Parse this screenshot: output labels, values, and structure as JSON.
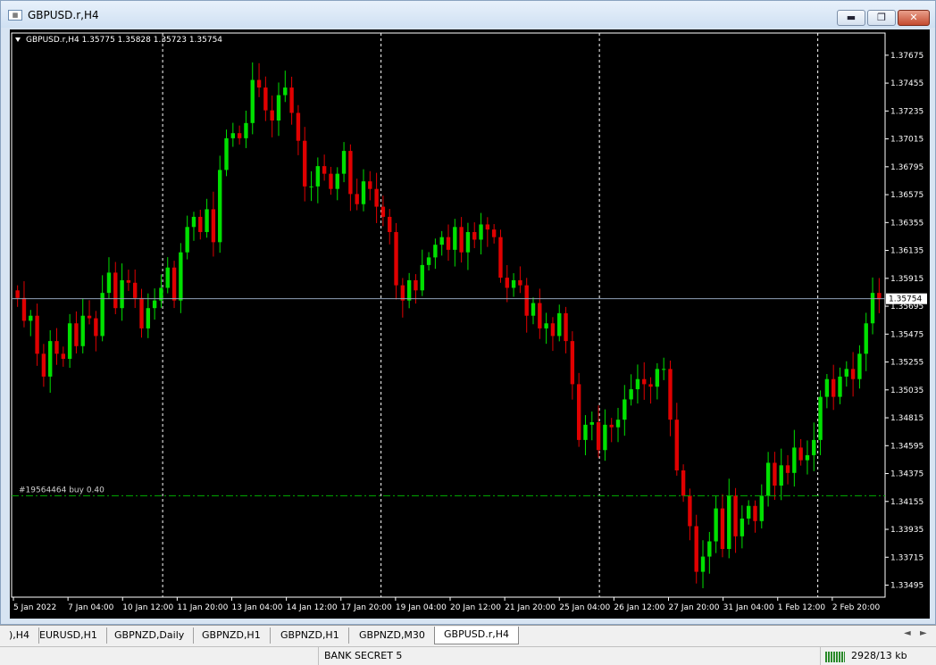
{
  "window": {
    "title": "GBPUSD.r,H4",
    "min_label": "▬",
    "max_label": "❐",
    "close_label": "✕"
  },
  "chart": {
    "header": "GBPUSD.r,H4  1.35775 1.35828 1.35723 1.35754",
    "current_price_label": "1.35754",
    "order_label": "#19564464 buy 0.40",
    "colors": {
      "bull": "#00e000",
      "bear": "#e00000",
      "bg": "#000000",
      "grid": "#ffffff",
      "price_line": "#8fa0b8",
      "order_line": "#00b000"
    }
  },
  "chart_data": {
    "type": "candlestick",
    "symbol": "GBPUSD.r",
    "timeframe": "H4",
    "ylim": [
      1.334,
      1.3785
    ],
    "y_ticks": [
      "1.37675",
      "1.37455",
      "1.37235",
      "1.37015",
      "1.36795",
      "1.36575",
      "1.36355",
      "1.36135",
      "1.35915",
      "1.35695",
      "1.35475",
      "1.35255",
      "1.35035",
      "1.34815",
      "1.34595",
      "1.34375",
      "1.34155",
      "1.33935",
      "1.33715",
      "1.33495"
    ],
    "x_ticks": [
      "5 Jan 2022",
      "7 Jan 04:00",
      "10 Jan 12:00",
      "11 Jan 20:00",
      "13 Jan 04:00",
      "14 Jan 12:00",
      "17 Jan 20:00",
      "19 Jan 04:00",
      "20 Jan 12:00",
      "21 Jan 20:00",
      "25 Jan 04:00",
      "26 Jan 12:00",
      "27 Jan 20:00",
      "31 Jan 04:00",
      "1 Feb 12:00",
      "2 Feb 20:00"
    ],
    "current_price": 1.35754,
    "order": {
      "price": 1.342
    },
    "closes": [
      1.3576,
      1.3558,
      1.3562,
      1.3532,
      1.3514,
      1.3542,
      1.3532,
      1.3528,
      1.3556,
      1.3538,
      1.3562,
      1.356,
      1.3546,
      1.358,
      1.3596,
      1.3568,
      1.359,
      1.3588,
      1.3576,
      1.3552,
      1.3568,
      1.3574,
      1.3584,
      1.36,
      1.3574,
      1.3612,
      1.3632,
      1.364,
      1.3628,
      1.3646,
      1.362,
      1.3677,
      1.3702,
      1.3706,
      1.3702,
      1.3714,
      1.3748,
      1.3742,
      1.3724,
      1.3716,
      1.3736,
      1.3742,
      1.3722,
      1.37,
      1.3664,
      1.3664,
      1.368,
      1.3674,
      1.3662,
      1.3674,
      1.3692,
      1.3658,
      1.365,
      1.3668,
      1.3662,
      1.3648,
      1.364,
      1.3628,
      1.3586,
      1.3574,
      1.359,
      1.3582,
      1.3602,
      1.3608,
      1.3618,
      1.3624,
      1.3614,
      1.3632,
      1.3612,
      1.3628,
      1.3622,
      1.3634,
      1.363,
      1.3624,
      1.3592,
      1.3584,
      1.359,
      1.3586,
      1.3562,
      1.3572,
      1.3552,
      1.3556,
      1.3546,
      1.3564,
      1.3542,
      1.3508,
      1.3464,
      1.3476,
      1.3478,
      1.3456,
      1.3476,
      1.3474,
      1.348,
      1.3496,
      1.3504,
      1.3512,
      1.3508,
      1.3506,
      1.352,
      1.352,
      1.348,
      1.344,
      1.342,
      1.3396,
      1.336,
      1.3372,
      1.3384,
      1.341,
      1.3378,
      1.342,
      1.3388,
      1.3402,
      1.3412,
      1.34,
      1.342,
      1.3446,
      1.3428,
      1.3444,
      1.3438,
      1.3458,
      1.3448,
      1.3452,
      1.3464,
      1.3498,
      1.3512,
      1.3498,
      1.3514,
      1.352,
      1.3512,
      1.3532,
      1.3556,
      1.358,
      1.3575
    ]
  },
  "tabs": [
    {
      "label": "),H4"
    },
    {
      "label": "EURUSD,H1"
    },
    {
      "label": "GBPNZD,Daily"
    },
    {
      "label": "GBPNZD,H1"
    },
    {
      "label": "GBPNZD,H1"
    },
    {
      "label": "GBPNZD,M30"
    },
    {
      "label": "GBPUSD.r,H4"
    }
  ],
  "tab_scroll_left": "◄",
  "tab_scroll_right": "►",
  "status": {
    "profile": "BANK SECRET 5",
    "traffic": "2928/13 kb"
  }
}
